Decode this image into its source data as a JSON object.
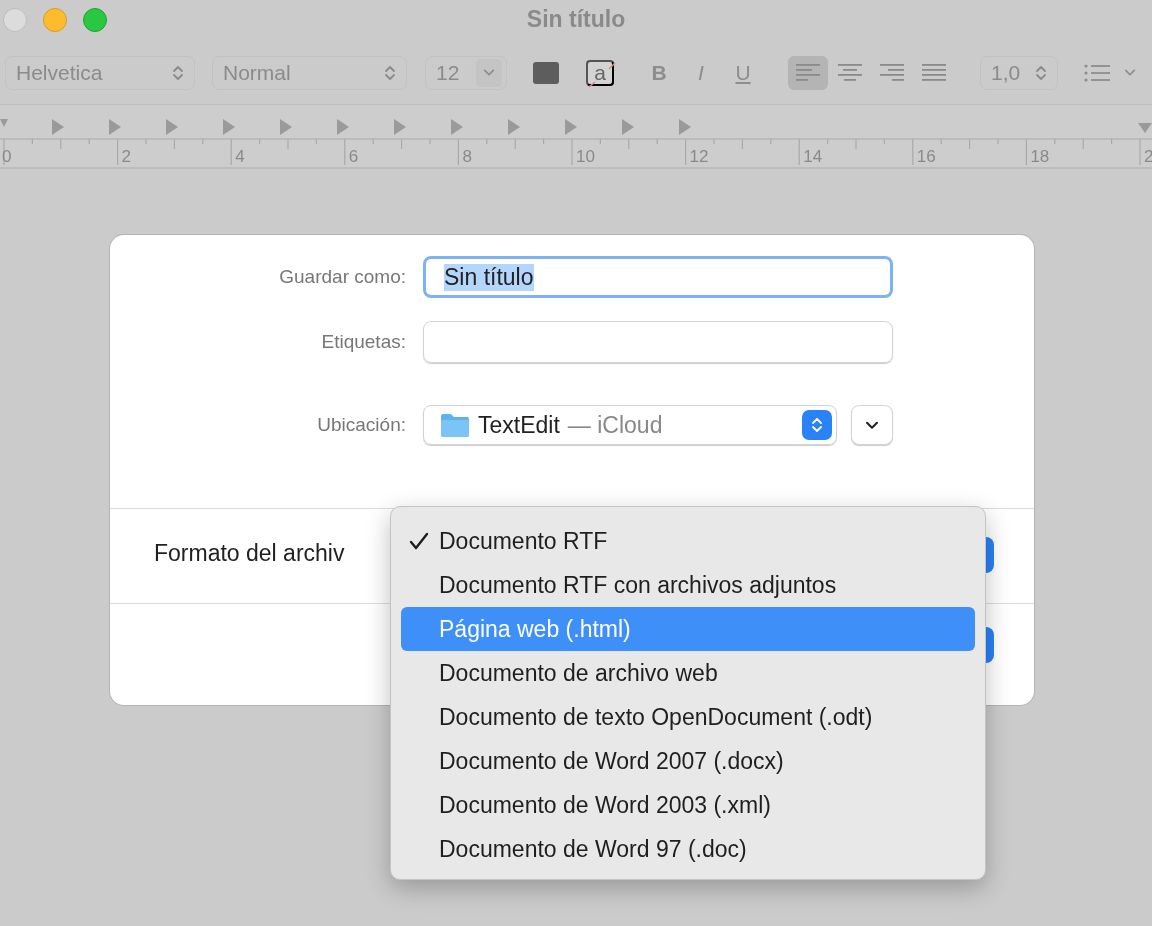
{
  "window": {
    "title": "Sin título"
  },
  "toolbar": {
    "font": "Helvetica",
    "style": "Normal",
    "size": "12",
    "strike_label": "a",
    "bold": "B",
    "italic": "I",
    "underline": "U",
    "alignments": [
      {
        "kind": "left",
        "selected": true
      },
      {
        "kind": "center",
        "selected": false
      },
      {
        "kind": "right",
        "selected": false
      },
      {
        "kind": "justify",
        "selected": false
      }
    ],
    "spacing": "1,0"
  },
  "ruler": {
    "numbers": [
      "0",
      "2",
      "4",
      "6",
      "8",
      "10",
      "12",
      "14",
      "16",
      "18",
      "2"
    ]
  },
  "dialog": {
    "save_as": {
      "label": "Guardar como:",
      "value": "Sin título"
    },
    "tags": {
      "label": "Etiquetas:"
    },
    "location": {
      "label": "Ubicación:",
      "folder": "TextEdit",
      "service": "— iCloud"
    },
    "format": {
      "label": "Formato del archiv"
    },
    "menu": [
      {
        "label": "Documento RTF",
        "checked": true,
        "selected": false
      },
      {
        "label": "Documento RTF con archivos adjuntos",
        "checked": false,
        "selected": false
      },
      {
        "label": "Página web (.html)",
        "checked": false,
        "selected": true
      },
      {
        "label": "Documento de archivo web",
        "checked": false,
        "selected": false
      },
      {
        "label": "Documento de texto OpenDocument (.odt)",
        "checked": false,
        "selected": false
      },
      {
        "label": "Documento de Word 2007 (.docx)",
        "checked": false,
        "selected": false
      },
      {
        "label": "Documento de Word 2003 (.xml)",
        "checked": false,
        "selected": false
      },
      {
        "label": "Documento de Word 97 (.doc)",
        "checked": false,
        "selected": false
      }
    ]
  }
}
